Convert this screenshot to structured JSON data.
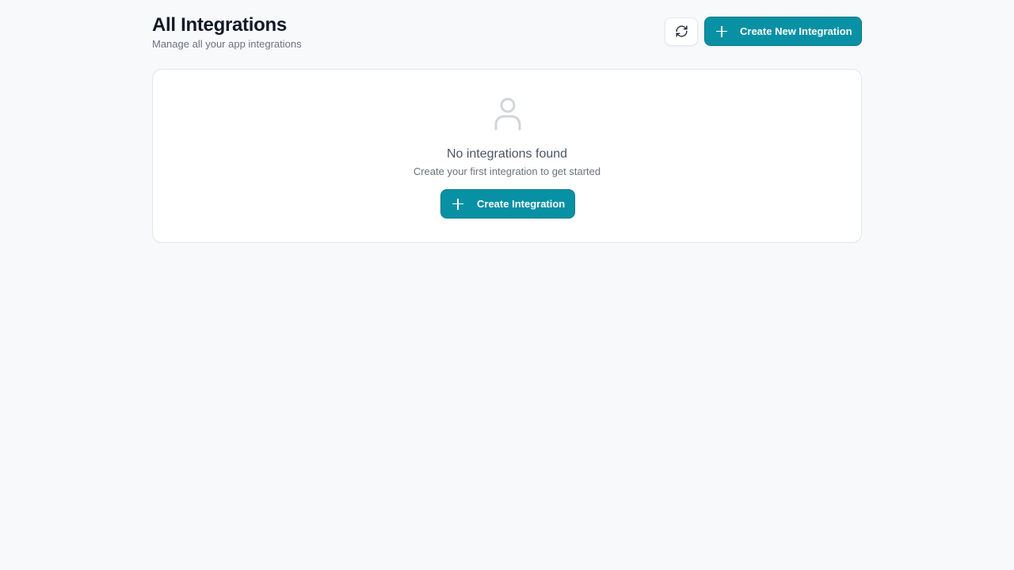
{
  "header": {
    "title": "All Integrations",
    "subtitle": "Manage all your app integrations",
    "refresh_icon": "refresh-icon",
    "create_new_label": "Create New Integration"
  },
  "empty_state": {
    "icon": "user-icon",
    "title": "No integrations found",
    "subtitle": "Create your first integration to get started",
    "create_label": "Create Integration"
  },
  "colors": {
    "accent": "#0891a4",
    "background": "#f8f9fb",
    "card": "#ffffff"
  }
}
